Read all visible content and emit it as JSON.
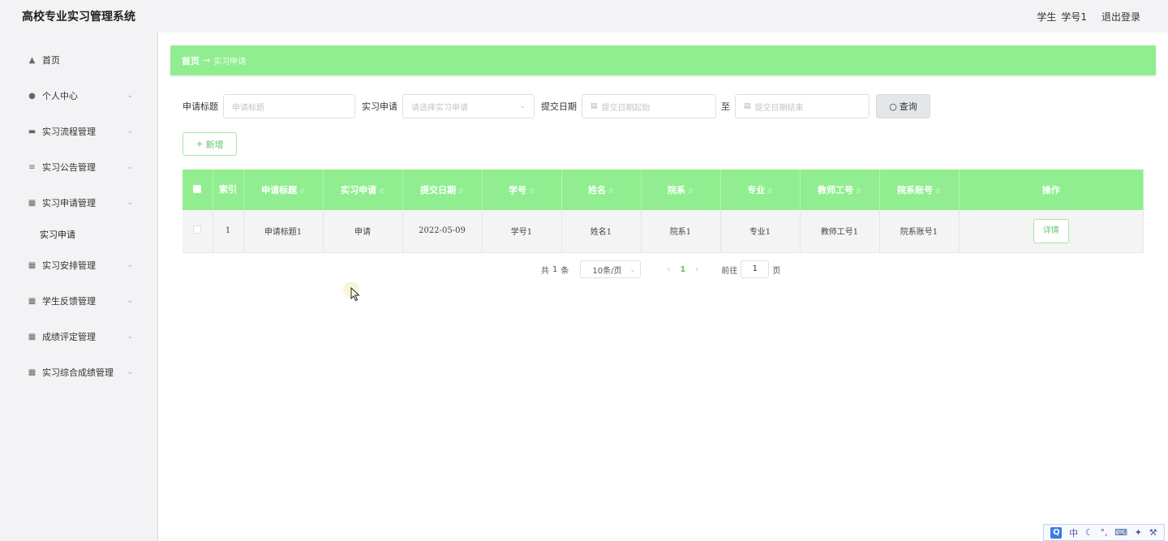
{
  "app": {
    "title": "高校专业实习管理系统"
  },
  "header": {
    "role": "学生",
    "username": "学号1",
    "logout": "退出登录"
  },
  "sidebar": {
    "items": [
      {
        "label": "首页",
        "icon": "home-icon"
      },
      {
        "label": "个人中心",
        "icon": "user-icon"
      },
      {
        "label": "实习流程管理",
        "icon": "briefcase-icon"
      },
      {
        "label": "实习公告管理",
        "icon": "list-icon"
      },
      {
        "label": "实习申请管理",
        "icon": "grid-icon",
        "sub": "实习申请"
      },
      {
        "label": "实习安排管理",
        "icon": "grid-icon"
      },
      {
        "label": "学生反馈管理",
        "icon": "grid-icon"
      },
      {
        "label": "成绩评定管理",
        "icon": "grid-icon"
      },
      {
        "label": "实习综合成绩管理",
        "icon": "grid-icon"
      }
    ]
  },
  "breadcrumb": {
    "home": "首页",
    "arrow": "→",
    "current": "实习申请"
  },
  "filters": {
    "title_label": "申请标题",
    "title_placeholder": "申请标题",
    "apply_label": "实习申请",
    "apply_placeholder": "请选择实习申请",
    "date_label": "提交日期",
    "date_start_placeholder": "提交日期起始",
    "date_to": "至",
    "date_end_placeholder": "提交日期结束",
    "search_label": "查询"
  },
  "actions": {
    "add_label": "新增"
  },
  "table": {
    "headers": [
      "索引",
      "申请标题",
      "实习申请",
      "提交日期",
      "学号",
      "姓名",
      "院系",
      "专业",
      "教师工号",
      "院系账号",
      "操作"
    ],
    "rows": [
      {
        "index": "1",
        "title": "申请标题1",
        "apply": "申请",
        "date": "2022-05-09",
        "student_no": "学号1",
        "name": "姓名1",
        "dept": "院系1",
        "major": "专业1",
        "teacher_no": "教师工号1",
        "dept_account": "院系账号1",
        "action": "详情"
      }
    ]
  },
  "pagination": {
    "total_prefix": "共",
    "total": "1",
    "total_suffix": "条",
    "page_size": "10条/页",
    "current_page": "1",
    "goto_label": "前往",
    "goto_value": "1",
    "page_suffix": "页"
  },
  "ime": {
    "lang": "中"
  },
  "colors": {
    "accent": "#90ee90",
    "sidebar_bg": "#f3f3f5"
  }
}
